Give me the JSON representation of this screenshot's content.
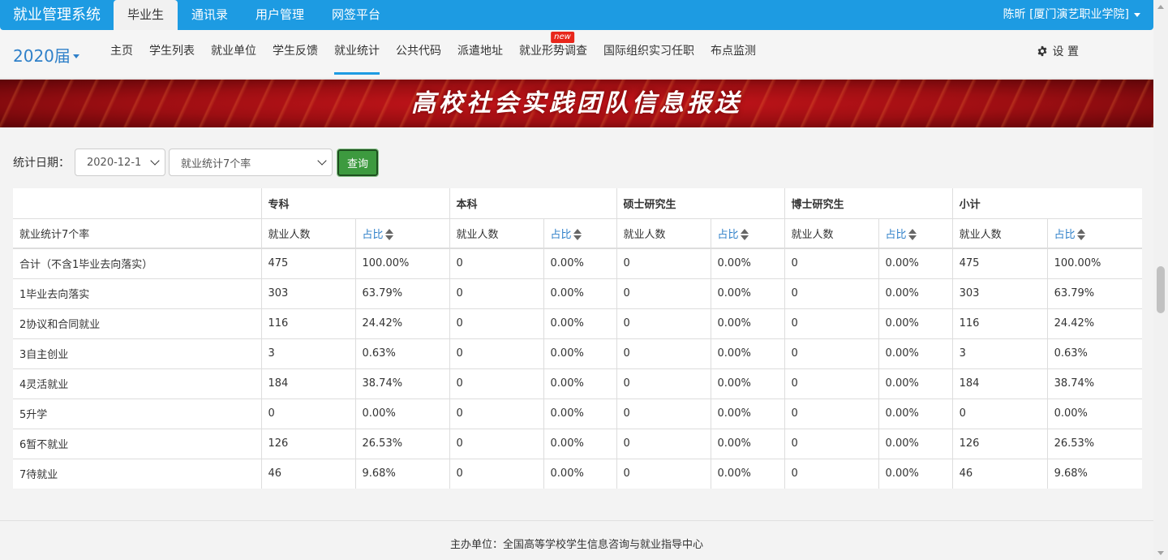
{
  "app": {
    "brand": "就业管理系统"
  },
  "topnav": [
    {
      "label": "毕业生",
      "active": true
    },
    {
      "label": "通讯录",
      "active": false
    },
    {
      "label": "用户管理",
      "active": false
    },
    {
      "label": "网签平台",
      "active": false
    }
  ],
  "user": {
    "name": "陈昕 [厦门演艺职业学院]"
  },
  "subbar": {
    "year": "2020届",
    "items": [
      {
        "label": "主页"
      },
      {
        "label": "学生列表"
      },
      {
        "label": "就业单位"
      },
      {
        "label": "学生反馈"
      },
      {
        "label": "就业统计",
        "active": true
      },
      {
        "label": "公共代码"
      },
      {
        "label": "派遣地址"
      },
      {
        "label": "就业形势调查",
        "badge": "new"
      },
      {
        "label": "国际组织实习任职"
      },
      {
        "label": "布点监测"
      }
    ],
    "settings": "设 置"
  },
  "banner": {
    "title": "高校社会实践团队信息报送"
  },
  "filter": {
    "label": "统计日期：",
    "date_value": "2020-12-1",
    "type_value": "就业统计7个率",
    "query_button": "查询"
  },
  "table": {
    "groups": [
      "专科",
      "本科",
      "硕士研究生",
      "博士研究生",
      "小计"
    ],
    "row_header": "就业统计7个率",
    "sub_count": "就业人数",
    "sub_ratio": "占比",
    "rows": [
      {
        "label": "合计（不含1毕业去向落实）",
        "cells": [
          "475",
          "100.00%",
          "0",
          "0.00%",
          "0",
          "0.00%",
          "0",
          "0.00%",
          "475",
          "100.00%"
        ]
      },
      {
        "label": "1毕业去向落实",
        "cells": [
          "303",
          "63.79%",
          "0",
          "0.00%",
          "0",
          "0.00%",
          "0",
          "0.00%",
          "303",
          "63.79%"
        ]
      },
      {
        "label": "2协议和合同就业",
        "cells": [
          "116",
          "24.42%",
          "0",
          "0.00%",
          "0",
          "0.00%",
          "0",
          "0.00%",
          "116",
          "24.42%"
        ]
      },
      {
        "label": "3自主创业",
        "cells": [
          "3",
          "0.63%",
          "0",
          "0.00%",
          "0",
          "0.00%",
          "0",
          "0.00%",
          "3",
          "0.63%"
        ]
      },
      {
        "label": "4灵活就业",
        "cells": [
          "184",
          "38.74%",
          "0",
          "0.00%",
          "0",
          "0.00%",
          "0",
          "0.00%",
          "184",
          "38.74%"
        ]
      },
      {
        "label": "5升学",
        "cells": [
          "0",
          "0.00%",
          "0",
          "0.00%",
          "0",
          "0.00%",
          "0",
          "0.00%",
          "0",
          "0.00%"
        ]
      },
      {
        "label": "6暂不就业",
        "cells": [
          "126",
          "26.53%",
          "0",
          "0.00%",
          "0",
          "0.00%",
          "0",
          "0.00%",
          "126",
          "26.53%"
        ]
      },
      {
        "label": "7待就业",
        "cells": [
          "46",
          "9.68%",
          "0",
          "0.00%",
          "0",
          "0.00%",
          "0",
          "0.00%",
          "46",
          "9.68%"
        ]
      }
    ]
  },
  "footer": {
    "text": "主办单位：全国高等学校学生信息咨询与就业指导中心"
  },
  "colors": {
    "navbar": "#1d9be2",
    "accent": "#2f80c9",
    "query_button": "#3d9a3f",
    "badge": "#e8261b",
    "banner": "#c9151b"
  }
}
